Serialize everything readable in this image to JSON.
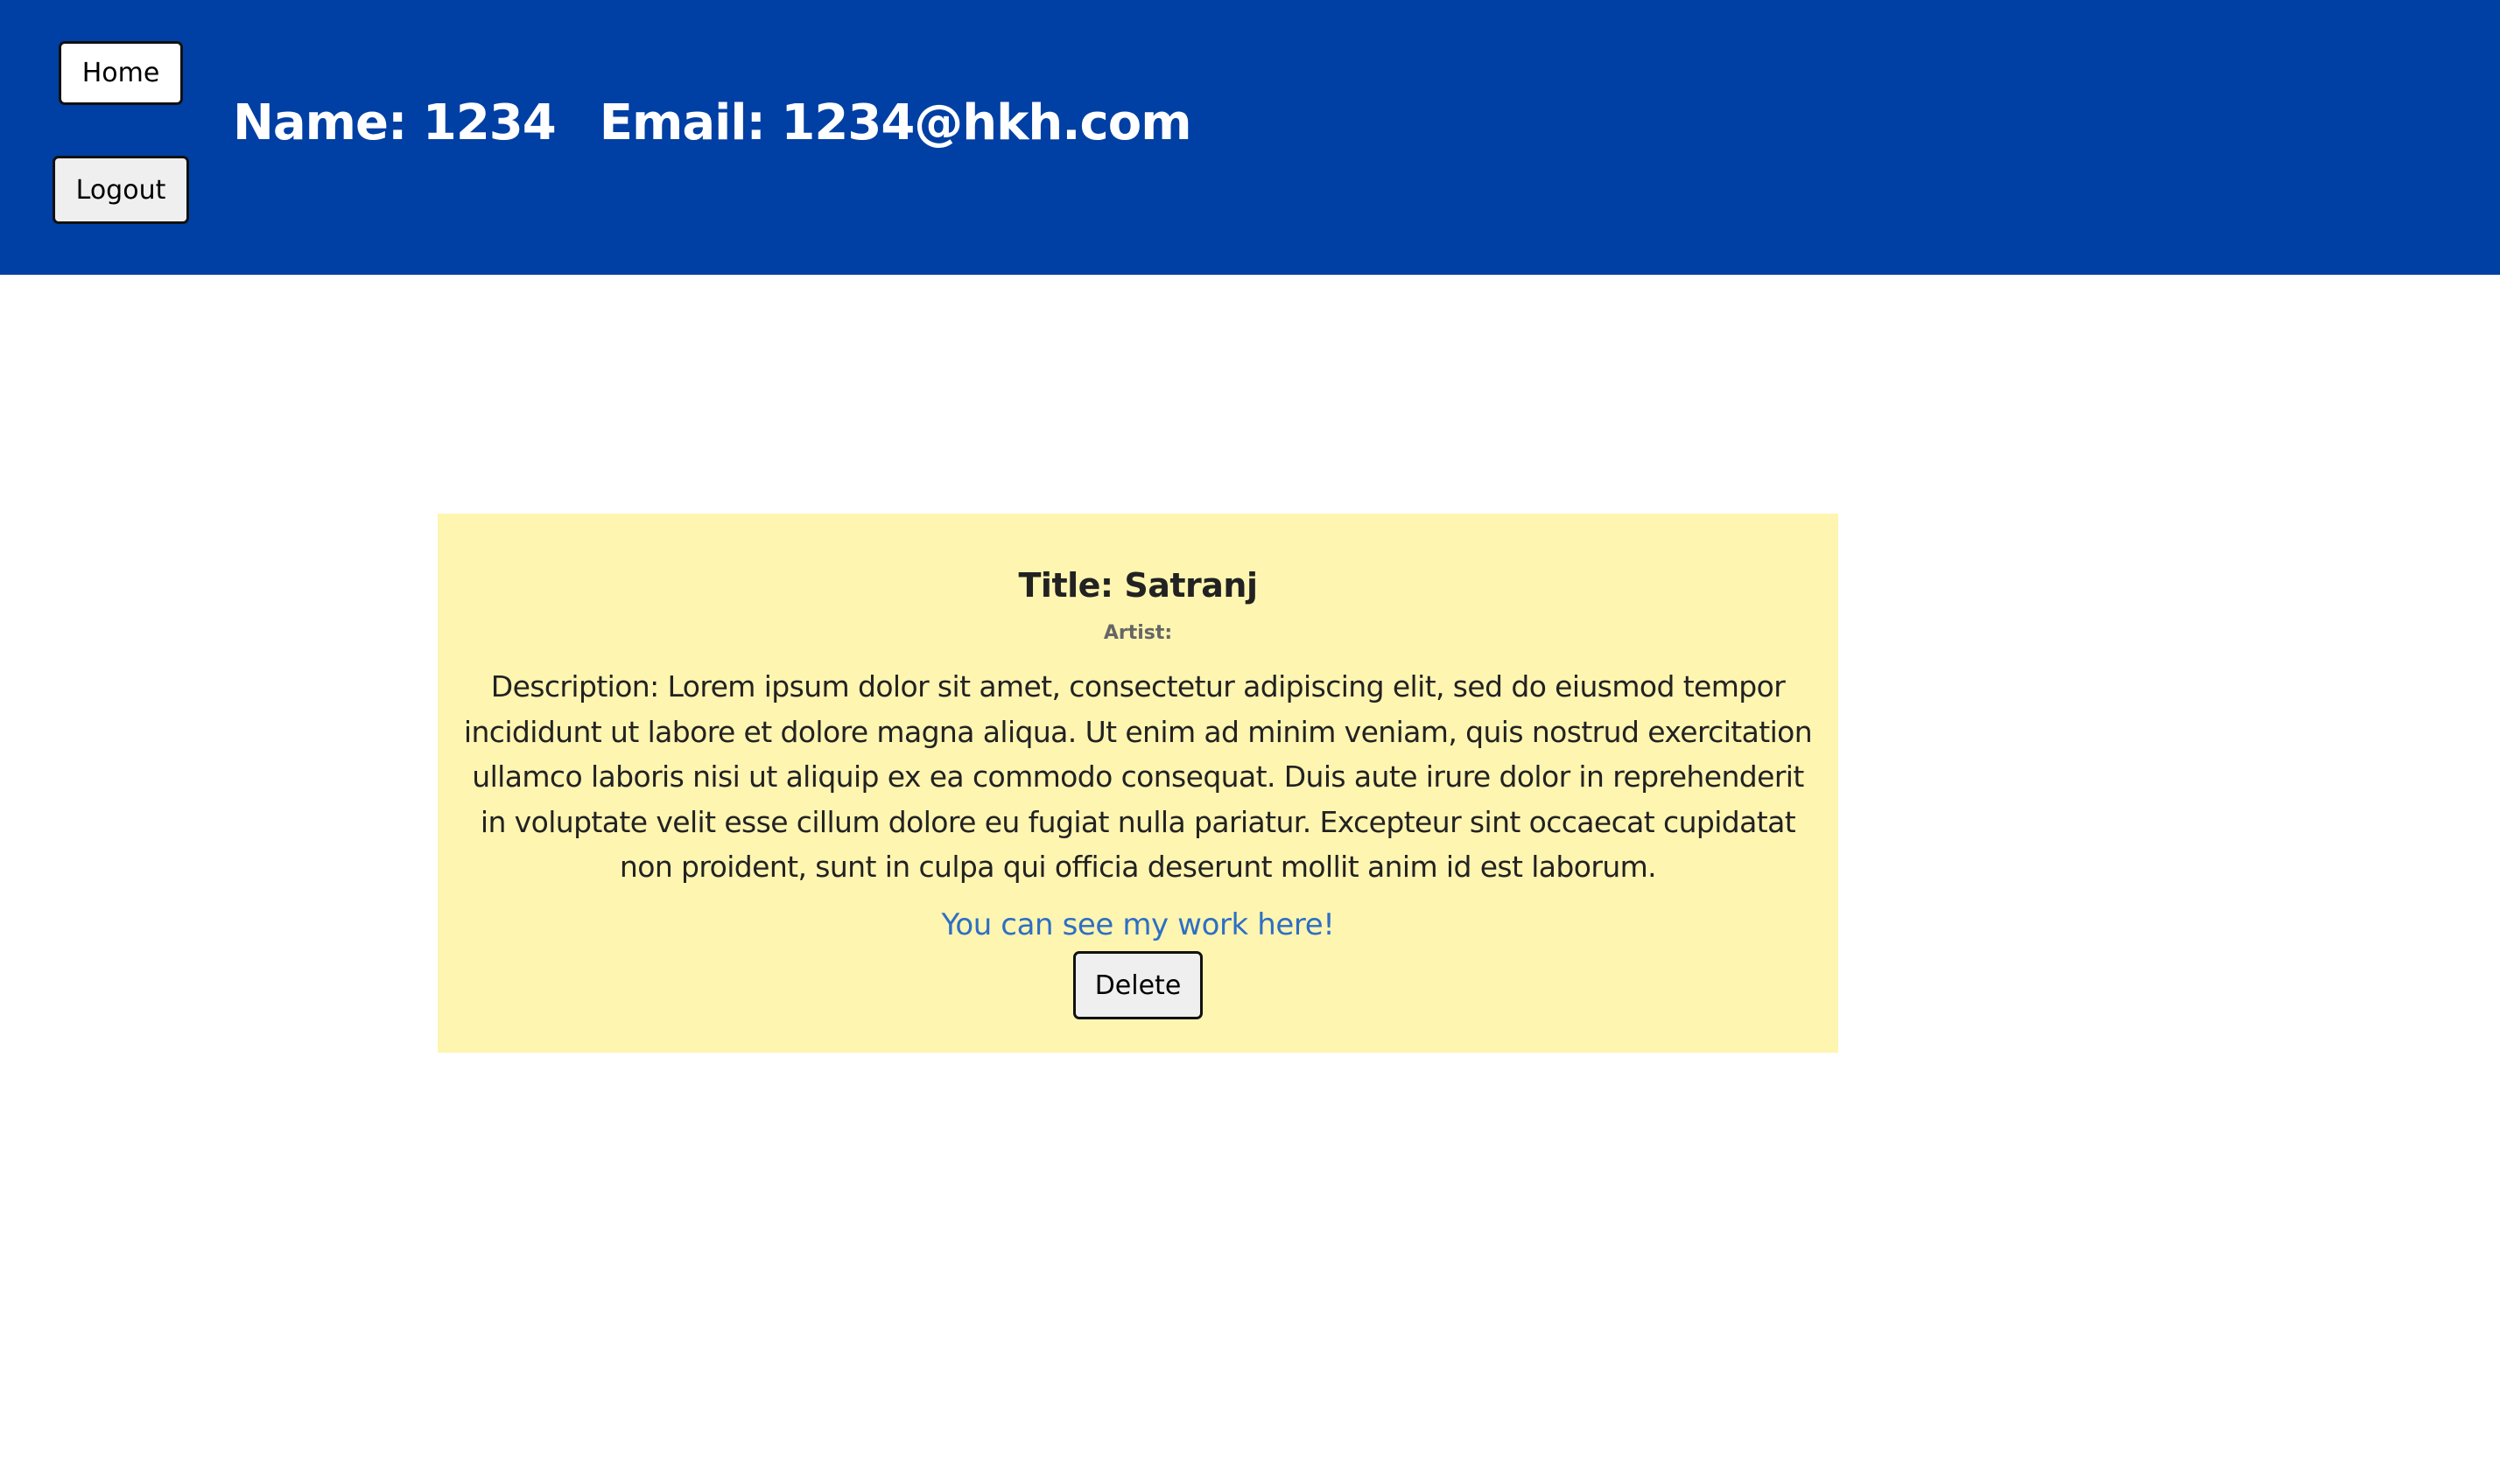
{
  "header": {
    "home_label": "Home",
    "logout_label": "Logout",
    "name_text": "Name: 1234",
    "email_text": "Email: 1234@hkh.com",
    "background_color": "#003fa3"
  },
  "card": {
    "title": "Title: Satranj",
    "artist": "Artist:",
    "description": "Description: Lorem ipsum dolor sit amet, consectetur adipiscing elit, sed do eiusmod tempor incididunt ut labore et dolore magna aliqua. Ut enim ad minim veniam, quis nostrud exercitation ullamco laboris nisi ut aliquip ex ea commodo consequat. Duis aute irure dolor in reprehenderit in voluptate velit esse cillum dolore eu fugiat nulla pariatur. Excepteur sint occaecat cupidatat non proident, sunt in culpa qui officia deserunt mollit anim id est laborum.",
    "link_text": "You can see my work here!",
    "delete_label": "Delete",
    "background_color": "#fef5b1",
    "link_color": "#2e6fc4"
  }
}
